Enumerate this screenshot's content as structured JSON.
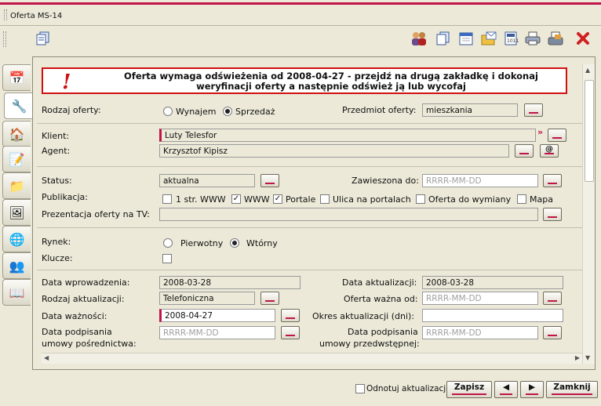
{
  "window": {
    "title": "Oferta MS-14"
  },
  "toolbar": {
    "left_icon": "copy-document-icon",
    "icons": [
      "users-icon",
      "documents-icon",
      "calendar-icon",
      "folder-mail-icon",
      "calculator-icon",
      "printer-icon",
      "fax-icon",
      "close-icon"
    ]
  },
  "sidetabs": [
    "calendar-icon",
    "tools-icon",
    "house-icon",
    "notes-icon",
    "folder-icon",
    "picture-icon",
    "globe-icon",
    "users-icon",
    "book-icon"
  ],
  "warning": {
    "text": "Oferta wymaga odświeżenia od 2008-04-27 - przejdź na drugą zakładkę i dokonaj weryfinacji oferty a następnie odśwież ją lub wycofaj"
  },
  "form": {
    "rodzaj_oferty_label": "Rodzaj oferty:",
    "wynajem": "Wynajem",
    "sprzedaz": "Sprzedaż",
    "przedmiot_label": "Przedmiot oferty:",
    "przedmiot_value": "mieszkania",
    "klient_label": "Klient:",
    "klient_value": "Luty Telesfor",
    "agent_label": "Agent:",
    "agent_value": "Krzysztof Kipisz",
    "at_label": "@",
    "status_label": "Status:",
    "status_value": "aktualna",
    "zawieszona_label": "Zawieszona do:",
    "date_placeholder": "RRRR-MM-DD",
    "publikacja_label": "Publikacja:",
    "pub_options": [
      "1 str. WWW",
      "WWW",
      "Portale",
      "Ulica na portalach",
      "Oferta do wymiany",
      "Mapa"
    ],
    "prezentacja_label": "Prezentacja oferty na TV:",
    "rynek_label": "Rynek:",
    "pierwotny": "Pierwotny",
    "wtorny": "Wtórny",
    "klucze_label": "Klucze:",
    "data_wprowadzenia_label": "Data wprowadzenia:",
    "data_wprowadzenia_value": "2008-03-28",
    "data_aktualizacji_label": "Data aktualizacji:",
    "data_aktualizacji_value": "2008-03-28",
    "rodzaj_aktualizacji_label": "Rodzaj aktualizacji:",
    "rodzaj_aktualizacji_value": "Telefoniczna",
    "oferta_wazna_label": "Oferta ważna od:",
    "data_waznosci_label": "Data ważności:",
    "data_waznosci_value": "2008-04-27",
    "okres_label": "Okres aktualizacji (dni):",
    "podpisania_posr_label1": "Data podpisania",
    "podpisania_posr_label2": "umowy pośrednictwa:",
    "podpisania_przedw_label1": "Data podpisania",
    "podpisania_przedw_label2": "umowy przedwstępnej:"
  },
  "footer": {
    "odnotuj": "Odnotuj aktualizacje",
    "zapisz": "Zapisz",
    "zamknij": "Zamknij"
  },
  "colors": {
    "accent": "#c0154a",
    "warning_border": "#d01010",
    "background": "#ece9d8"
  }
}
